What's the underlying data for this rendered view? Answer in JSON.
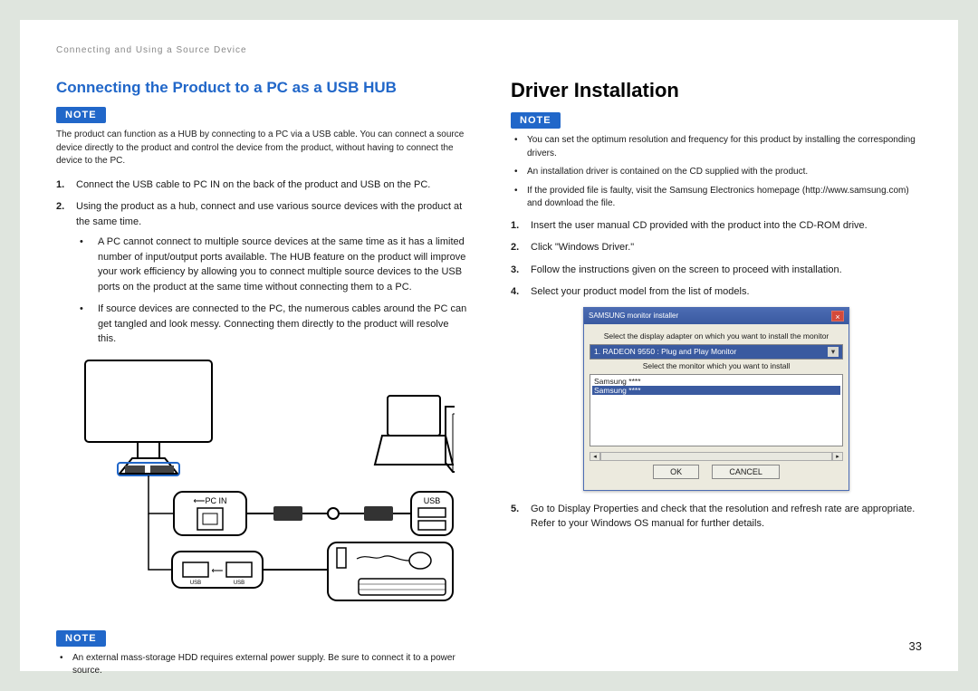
{
  "breadcrumb": "Connecting and Using a Source Device",
  "page_number": "33",
  "left": {
    "heading": "Connecting the Product to a PC as a USB HUB",
    "note1_label": "NOTE",
    "note1_text": "The product can function as a HUB by connecting to a PC via a USB cable. You can connect a source device directly to the product and control the device from the product, without having to connect the device to the PC.",
    "steps": [
      "Connect the USB cable to PC IN on the back of the product and USB on the PC.",
      "Using the product as a hub, connect and use various source devices with the product at the same time."
    ],
    "inner_bullets": [
      "A PC cannot connect to multiple source devices at the same time as it has a limited number of input/output ports available. The HUB feature on the product will improve your work efficiency by allowing you to connect multiple source devices to the USB ports on the product at the same time without connecting them to a PC.",
      "If source devices are connected to the PC, the numerous cables around the PC can get tangled and look messy. Connecting them directly to the product will resolve this."
    ],
    "diagram_labels": {
      "pc_in": "PC IN",
      "usb": "USB",
      "usb_port": "USB"
    },
    "note2_label": "NOTE",
    "note2_bullet": "An external mass-storage HDD requires external power supply. Be sure to connect it to a power source."
  },
  "right": {
    "heading": "Driver Installation",
    "note_label": "NOTE",
    "note_bullets": [
      "You can set the optimum resolution and frequency for this product by installing the corresponding drivers.",
      "An installation driver is contained on the CD supplied with the product.",
      "If the provided file is faulty, visit the Samsung Electronics homepage (http://www.samsung.com) and download the file."
    ],
    "steps": [
      "Insert the user manual CD provided with the product into the CD-ROM drive.",
      "Click \"Windows Driver.\"",
      "Follow the instructions given on the screen to proceed with installation.",
      "Select your product model from the list of models.",
      "Go to Display Properties and check that the resolution and refresh rate are appropriate. Refer to your Windows OS manual for further details."
    ],
    "dialog": {
      "title": "SAMSUNG monitor installer",
      "label_top": "Select the display adapter on which you want to install the monitor",
      "select_value": "1. RADEON 9550 : Plug and Play Monitor",
      "label_mid": "Select the monitor which you want to install",
      "list_items": [
        "Samsung ****",
        "Samsung ****"
      ],
      "btn_ok": "OK",
      "btn_cancel": "CANCEL"
    }
  }
}
